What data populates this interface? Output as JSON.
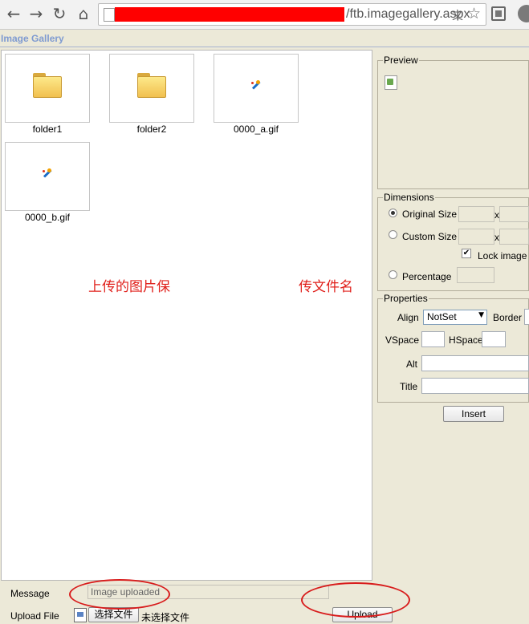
{
  "browser": {
    "back_glyph": "←",
    "forward_glyph": "→",
    "reload_glyph": "↻",
    "home_glyph": "⌂",
    "url_visible": "/ftb.imagegallery.aspx",
    "star_glyph": "☆",
    "translate_glyph": "文"
  },
  "page": {
    "title": "Image Gallery"
  },
  "gallery": {
    "items": [
      {
        "label": "folder1",
        "kind": "folder-icon"
      },
      {
        "label": "folder2",
        "kind": "folder-icon"
      },
      {
        "label": "0000_a.gif",
        "kind": "image-icon"
      },
      {
        "label": "0000_b.gif",
        "kind": "image-icon"
      }
    ],
    "overlay_left": "上传的图片保",
    "overlay_right": "传文件名"
  },
  "preview": {
    "legend": "Preview"
  },
  "dimensions": {
    "legend": "Dimensions",
    "original_label": "Original Size",
    "custom_label": "Custom Size",
    "x_sep": "x",
    "lock_label": "Lock image",
    "lock_checked": true,
    "percentage_label": "Percentage",
    "selected": "original"
  },
  "properties": {
    "legend": "Properties",
    "align_label": "Align",
    "align_value": "NotSet",
    "border_label": "Border",
    "vspace_label": "VSpace",
    "hspace_label": "HSpace",
    "alt_label": "Alt",
    "title_label": "Title"
  },
  "actions": {
    "insert_label": "Insert",
    "upload_label": "Upload"
  },
  "bottom": {
    "message_label": "Message",
    "message_value": "Image uploaded",
    "upload_file_label": "Upload File",
    "choose_file_label": "选择文件",
    "no_file_label": "未选择文件"
  },
  "colors": {
    "annotation": "#d81c1c",
    "redaction": "#ff0000",
    "title": "#7f9bd1"
  }
}
